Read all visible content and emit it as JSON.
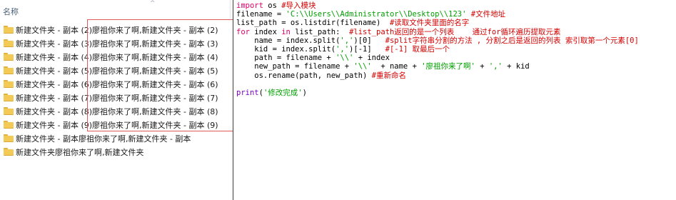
{
  "explorer": {
    "column_header": "名称",
    "files": [
      "新建文件夹 - 副本 (2)廖祖你来了啊,新建文件夹 - 副本 (2)",
      "新建文件夹 - 副本 (3)廖祖你来了啊,新建文件夹 - 副本 (3)",
      "新建文件夹 - 副本 (4)廖祖你来了啊,新建文件夹 - 副本 (4)",
      "新建文件夹 - 副本 (5)廖祖你来了啊,新建文件夹 - 副本 (5)",
      "新建文件夹 - 副本 (6)廖祖你来了啊,新建文件夹 - 副本 (6)",
      "新建文件夹 - 副本 (7)廖祖你来了啊,新建文件夹 - 副本 (7)",
      "新建文件夹 - 副本 (8)廖祖你来了啊,新建文件夹 - 副本 (8)",
      "新建文件夹 - 副本 (9)廖祖你来了啊,新建文件夹 - 副本 (9)",
      "新建文件夹 - 副本廖祖你来了啊,新建文件夹 - 副本",
      "新建文件夹廖祖你来了啊,新建文件夹"
    ]
  },
  "code": {
    "lines": [
      [
        [
          "kw",
          "import"
        ],
        [
          "nm",
          " os "
        ],
        [
          "cm",
          "#导入模块"
        ]
      ],
      [
        [
          "nm",
          "filename = "
        ],
        [
          "st",
          "'C:\\\\Users\\\\Administrator\\\\Desktop\\\\123'"
        ],
        [
          "nm",
          " "
        ],
        [
          "cm",
          "#文件地址"
        ]
      ],
      [
        [
          "nm",
          "list_path = os.listdir(filename)  "
        ],
        [
          "cm",
          "#读取文件夹里面的名字"
        ]
      ],
      [
        [
          "kw",
          "for"
        ],
        [
          "nm",
          " index "
        ],
        [
          "kw",
          "in"
        ],
        [
          "nm",
          " list_path:  "
        ],
        [
          "cm",
          "#list_path返回的是一个列表    通过for循环遍历提取元素"
        ]
      ],
      [
        [
          "nm",
          "    name = index.split("
        ],
        [
          "st",
          "','"
        ],
        [
          "nm",
          ")[0]   "
        ],
        [
          "cm",
          "#split字符串分割的方法 , 分割之后是返回的列表 索引取第一个元素[0]"
        ]
      ],
      [
        [
          "nm",
          "    kid = index.split("
        ],
        [
          "st",
          "','"
        ],
        [
          "nm",
          ")[-1]   "
        ],
        [
          "cm",
          "#[-1] 取最后一个"
        ]
      ],
      [
        [
          "nm",
          "    path = filename + "
        ],
        [
          "st",
          "'\\\\'"
        ],
        [
          "nm",
          " + index"
        ]
      ],
      [
        [
          "nm",
          "    new_path = filename + "
        ],
        [
          "st",
          "'\\\\'"
        ],
        [
          "nm",
          "  + name + "
        ],
        [
          "st",
          "'廖祖你来了啊'"
        ],
        [
          "nm",
          " + "
        ],
        [
          "st",
          "','"
        ],
        [
          "nm",
          " + kid"
        ]
      ],
      [
        [
          "nm",
          "    os.rename(path, new_path) "
        ],
        [
          "cm",
          "#重新命名"
        ]
      ],
      [],
      [
        [
          "fn",
          "print"
        ],
        [
          "nm",
          "("
        ],
        [
          "st",
          "'修改完成'"
        ],
        [
          "nm",
          ")"
        ]
      ]
    ]
  },
  "colors": {
    "keyword": "#e0006a",
    "comment": "#d40000",
    "string": "#00a000",
    "builtin": "#7a00c8",
    "annotation_box": "#e05a5a",
    "folder": "#f4ca57"
  },
  "icons": {
    "folder": "folder-icon",
    "sort": "sort-ascending-icon"
  }
}
